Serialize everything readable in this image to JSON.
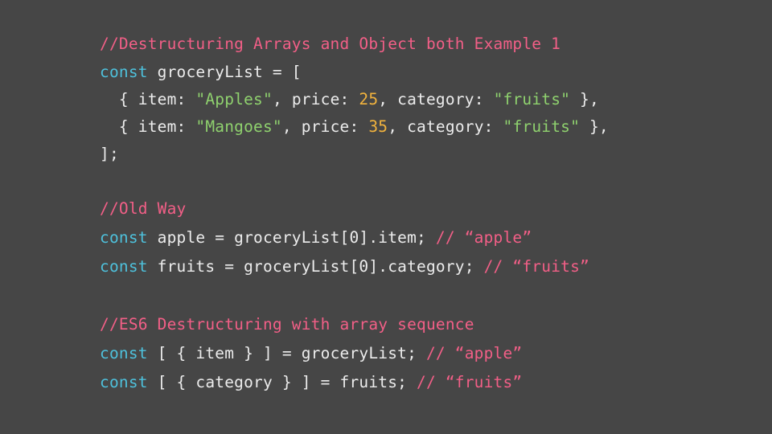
{
  "colors": {
    "background": "#464646",
    "comment": "#f25f87",
    "keyword": "#4ec1dc",
    "string": "#8fd16e",
    "number": "#f2b33d",
    "text": "#ececec"
  },
  "code_lines": [
    {
      "tokens": [
        {
          "type": "comment",
          "text": "//Destructuring Arrays and Object both Example 1"
        }
      ]
    },
    {
      "tokens": [
        {
          "type": "kw",
          "text": "const"
        },
        {
          "type": "plain",
          "text": " groceryList = ["
        }
      ]
    },
    {
      "tokens": [
        {
          "type": "plain",
          "text": "  { item: "
        },
        {
          "type": "str",
          "text": "\"Apples\""
        },
        {
          "type": "plain",
          "text": ", price: "
        },
        {
          "type": "num",
          "text": "25"
        },
        {
          "type": "plain",
          "text": ", category: "
        },
        {
          "type": "str",
          "text": "\"fruits\""
        },
        {
          "type": "plain",
          "text": " },"
        }
      ]
    },
    {
      "tokens": [
        {
          "type": "plain",
          "text": "  { item: "
        },
        {
          "type": "str",
          "text": "\"Mangoes\""
        },
        {
          "type": "plain",
          "text": ", price: "
        },
        {
          "type": "num",
          "text": "35"
        },
        {
          "type": "plain",
          "text": ", category: "
        },
        {
          "type": "str",
          "text": "\"fruits\""
        },
        {
          "type": "plain",
          "text": " },"
        }
      ]
    },
    {
      "tokens": [
        {
          "type": "plain",
          "text": "];"
        }
      ]
    },
    {
      "tokens": [
        {
          "type": "comment",
          "text": "//Old Way"
        }
      ]
    },
    {
      "tokens": [
        {
          "type": "kw",
          "text": "const"
        },
        {
          "type": "plain",
          "text": " apple = groceryList[0].item; "
        },
        {
          "type": "comment",
          "text": "// “apple”"
        }
      ]
    },
    {
      "tokens": [
        {
          "type": "kw",
          "text": "const"
        },
        {
          "type": "plain",
          "text": " fruits = groceryList[0].category; "
        },
        {
          "type": "comment",
          "text": "// “fruits”"
        }
      ]
    },
    {
      "tokens": [
        {
          "type": "comment",
          "text": "//ES6 Destructuring with array sequence"
        }
      ]
    },
    {
      "tokens": [
        {
          "type": "kw",
          "text": "const"
        },
        {
          "type": "plain",
          "text": " [ { item } ] = groceryList; "
        },
        {
          "type": "comment",
          "text": "// “apple”"
        }
      ]
    },
    {
      "tokens": [
        {
          "type": "kw",
          "text": "const"
        },
        {
          "type": "plain",
          "text": " [ { category } ] = fruits; "
        },
        {
          "type": "comment",
          "text": "// “fruits”"
        }
      ]
    }
  ]
}
